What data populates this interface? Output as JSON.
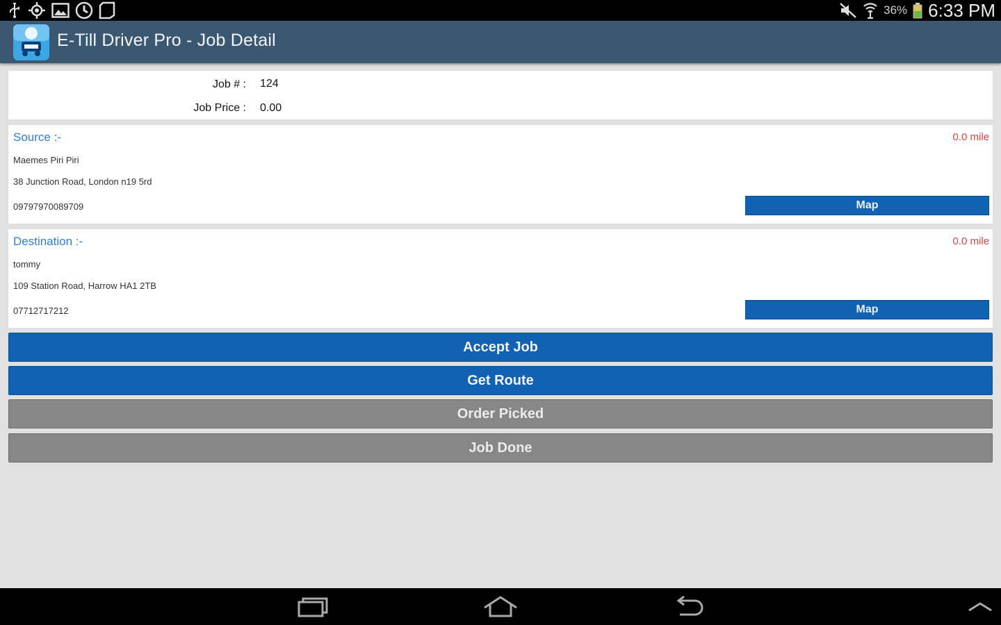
{
  "status_bar": {
    "battery": "36%",
    "time": "6:33 PM",
    "left_icons": [
      "usb-icon",
      "gps-icon",
      "image-icon",
      "sync-icon",
      "note-icon"
    ],
    "right_icons": [
      "mute-icon",
      "wifi-icon",
      "battery-icon"
    ]
  },
  "action_bar": {
    "title": "E-Till Driver Pro - Job Detail",
    "icon": "app-truck-icon"
  },
  "job": {
    "number_label": "Job # :",
    "number_value": "124",
    "price_label": "Job Price :",
    "price_value": "0.00"
  },
  "source": {
    "title": "Source :-",
    "distance": "0.0 mile",
    "name": "Maemes Piri Piri",
    "address": "38 Junction Road, London n19 5rd",
    "phone": "09797970089709",
    "map_label": "Map"
  },
  "destination": {
    "title": "Destination :-",
    "distance": "0.0 mile",
    "name": "tommy",
    "address": "109 Station Road, Harrow HA1 2TB",
    "phone": "07712717212",
    "map_label": "Map"
  },
  "actions": {
    "accept": "Accept Job",
    "route": "Get Route",
    "picked": "Order Picked",
    "done": "Job Done"
  },
  "colors": {
    "action_bar": "#3b5873",
    "primary_button": "#1262b3",
    "disabled_button": "#878787",
    "section_title": "#2e7fd3",
    "distance": "#ee3c3c",
    "background": "#e1e1e1"
  },
  "nav_bar": {
    "icons": [
      "recent-apps-icon",
      "home-icon",
      "back-icon",
      "chevron-up-icon"
    ]
  }
}
